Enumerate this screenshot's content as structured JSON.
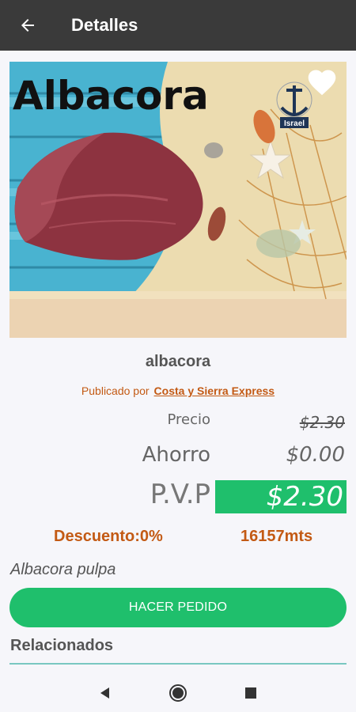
{
  "header": {
    "title": "Detalles",
    "back_icon": "arrow-left-icon"
  },
  "hero": {
    "image_title": "Albacora",
    "logo_text": "Israel",
    "favorite_icon": "heart-icon",
    "colors": {
      "sky": "#49b3d0",
      "sand": "#e9d6a4",
      "tuna": "#8d3340"
    }
  },
  "product": {
    "name": "albacora",
    "published_by_label": "Publicado por",
    "publisher": "Costa y Sierra Express",
    "description": "Albacora pulpa"
  },
  "pricing": {
    "precio_label": "Precio",
    "precio_value": "$2.30",
    "ahorro_label": "Ahorro",
    "ahorro_value": "$0.00",
    "pvp_label": "P.V.P",
    "pvp_value": "$2.30",
    "descuento": "Descuento:0%",
    "distancia": "16157mts"
  },
  "actions": {
    "order_label": "HACER PEDIDO"
  },
  "related": {
    "title": "Relacionados"
  },
  "navbar": {
    "icons": [
      "back-triangle-icon",
      "home-circle-icon",
      "recents-square-icon"
    ]
  },
  "colors": {
    "accent_green": "#1fbf6c",
    "orange_text": "#c35a14",
    "appbar": "#3a3a3a"
  }
}
